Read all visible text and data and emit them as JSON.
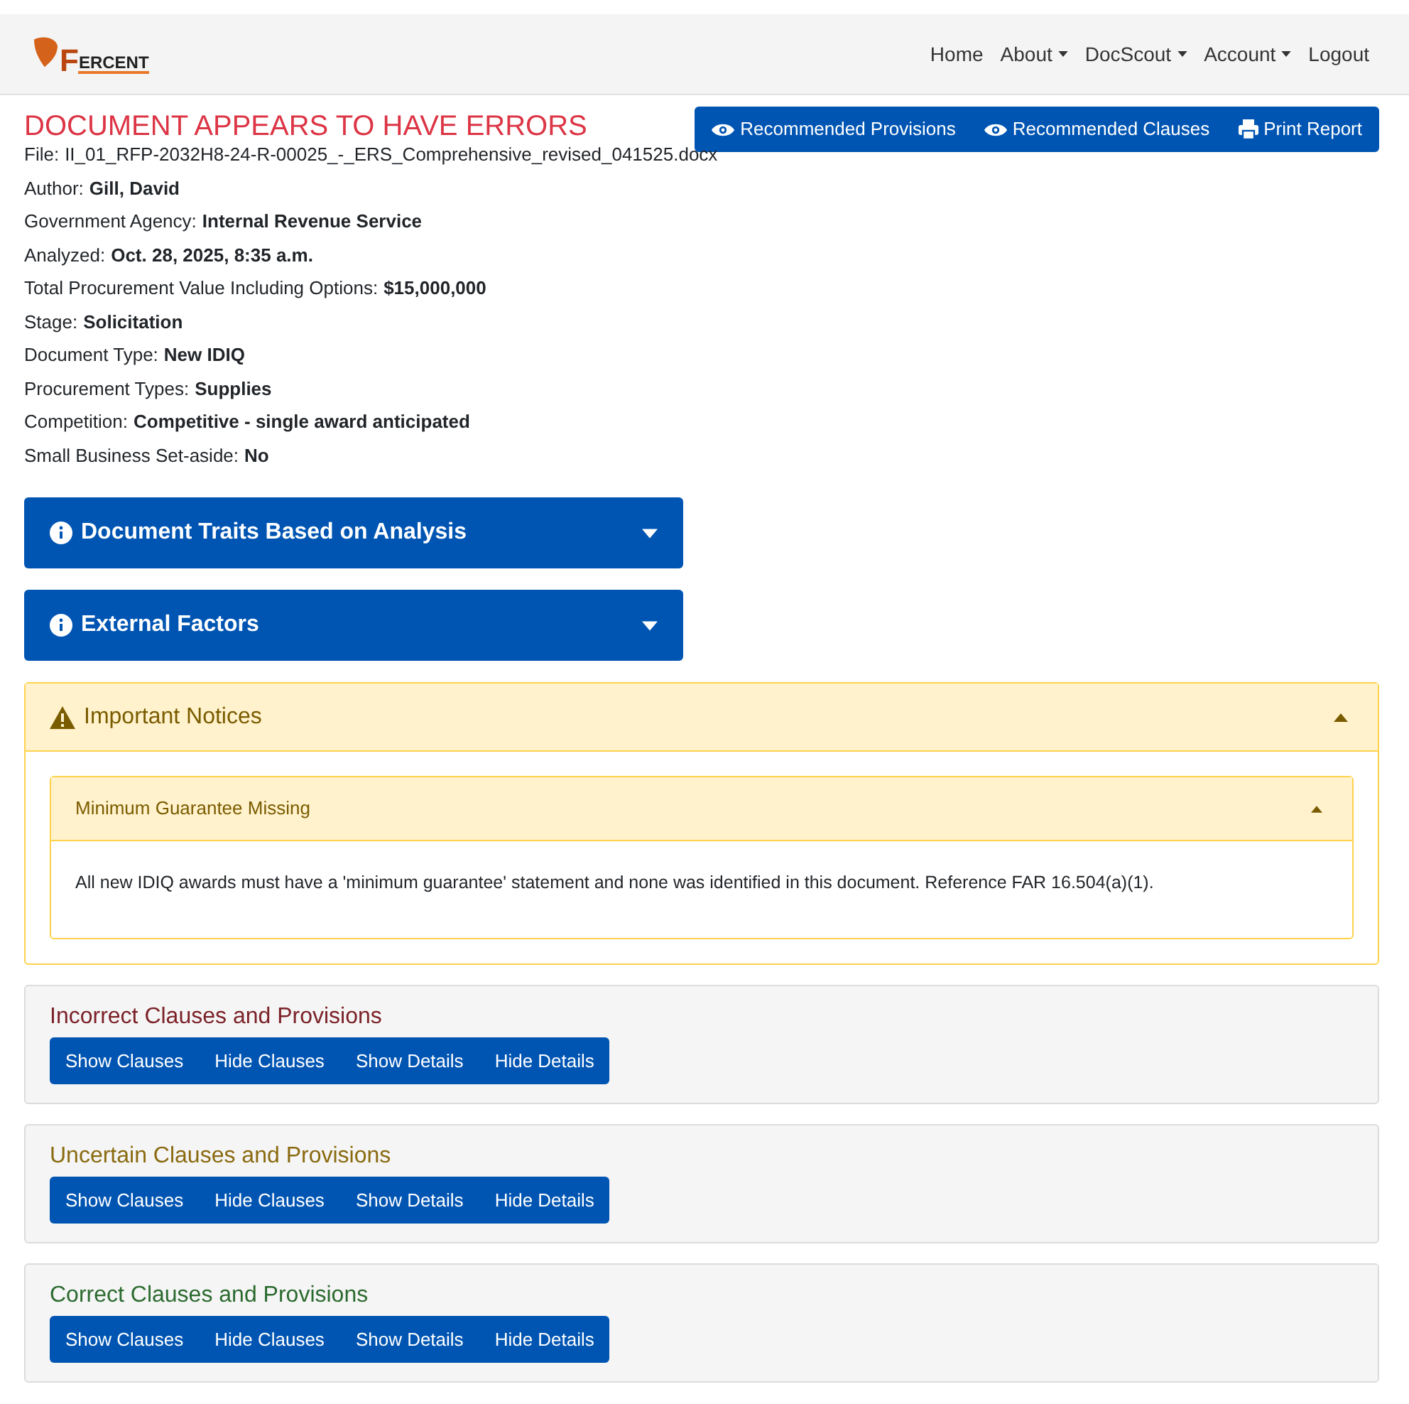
{
  "logo": {
    "initial": "F",
    "rest": "ERCENT"
  },
  "nav": [
    {
      "label": "Home",
      "dropdown": false
    },
    {
      "label": "About",
      "dropdown": true
    },
    {
      "label": "DocScout",
      "dropdown": true
    },
    {
      "label": "Account",
      "dropdown": true
    },
    {
      "label": "Logout",
      "dropdown": false
    }
  ],
  "title": "DOCUMENT APPEARS TO HAVE ERRORS",
  "actions": [
    {
      "label": "Recommended Provisions",
      "kind": "view"
    },
    {
      "label": "Recommended Clauses",
      "kind": "view"
    },
    {
      "label": "Print Report",
      "kind": "print"
    }
  ],
  "details": [
    {
      "label": "File:",
      "value": "II_01_RFP-2032H8-24-R-00025_-_ERS_Comprehensive_revised_041525.docx",
      "bold": false
    },
    {
      "label": "Author:",
      "value": "Gill, David",
      "bold": true
    },
    {
      "label": "Government Agency:",
      "value": "Internal Revenue Service",
      "bold": true
    },
    {
      "label": "Analyzed:",
      "value": "Oct. 28, 2025, 8:35 a.m.",
      "bold": true
    },
    {
      "label": "Total Procurement Value Including Options:",
      "value": "$15,000,000",
      "bold": true
    },
    {
      "label": "Stage:",
      "value": "Solicitation",
      "bold": true
    },
    {
      "label": "Document Type:",
      "value": "New IDIQ",
      "bold": true
    },
    {
      "label": "Procurement Types:",
      "value": "Supplies",
      "bold": true
    },
    {
      "label": "Competition:",
      "value": "Competitive - single award anticipated",
      "bold": true
    },
    {
      "label": "Small Business Set-aside:",
      "value": "No",
      "bold": true
    }
  ],
  "info_panels": [
    {
      "title": "Document Traits Based on Analysis",
      "expanded": false
    },
    {
      "title": "External Factors",
      "expanded": false
    }
  ],
  "notices": {
    "title": "Important Notices",
    "expanded": true,
    "items": [
      {
        "title": "Minimum Guarantee Missing",
        "expanded": true,
        "text": "All new IDIQ awards must have a 'minimum guarantee' statement and none was identified in this document. Reference FAR 16.504(a)(1)."
      }
    ]
  },
  "sections": [
    {
      "title": "Incorrect Clauses and Provisions",
      "color": "#7b2228",
      "buttons": [
        "Show Clauses",
        "Hide Clauses",
        "Show Details",
        "Hide Details"
      ]
    },
    {
      "title": "Uncertain Clauses and Provisions",
      "color": "#8a6a10",
      "buttons": [
        "Show Clauses",
        "Hide Clauses",
        "Show Details",
        "Hide Details"
      ]
    },
    {
      "title": "Correct Clauses and Provisions",
      "color": "#2b6a2f",
      "buttons": [
        "Show Clauses",
        "Hide Clauses",
        "Show Details",
        "Hide Details"
      ]
    }
  ]
}
